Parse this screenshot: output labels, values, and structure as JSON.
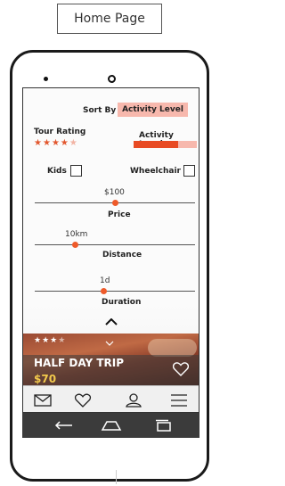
{
  "page_title": "Home Page",
  "sort": {
    "label": "Sort By",
    "selected": "Activity Level"
  },
  "tour_rating": {
    "label": "Tour Rating",
    "stars_filled": 4,
    "stars_total": 5
  },
  "activity_level": {
    "label": "Activity Level",
    "fill_percent": 70,
    "color": "#e84b24",
    "track_color": "#f7b8ad"
  },
  "filters": {
    "kids_label": "Kids",
    "wheelchair_label": "Wheelchair"
  },
  "sliders": {
    "price": {
      "value": "$100",
      "label": "Price",
      "position_percent": 50
    },
    "distance": {
      "value": "10km",
      "label": "Distance",
      "position_percent": 25
    },
    "duration": {
      "value": "1d",
      "label": "Duration",
      "position_percent": 43
    }
  },
  "card": {
    "title": "HALF DAY TRIP",
    "price": "$70",
    "stars_filled": 3,
    "stars_total": 4
  },
  "tabs": [
    "mail-icon",
    "heart-icon",
    "user-icon",
    "menu-icon"
  ],
  "nav_buttons": [
    "back-icon",
    "home-icon",
    "recent-apps-icon"
  ],
  "colors": {
    "accent": "#ee5a2a",
    "highlight": "#f7b8ad",
    "price": "#f2c94c"
  }
}
